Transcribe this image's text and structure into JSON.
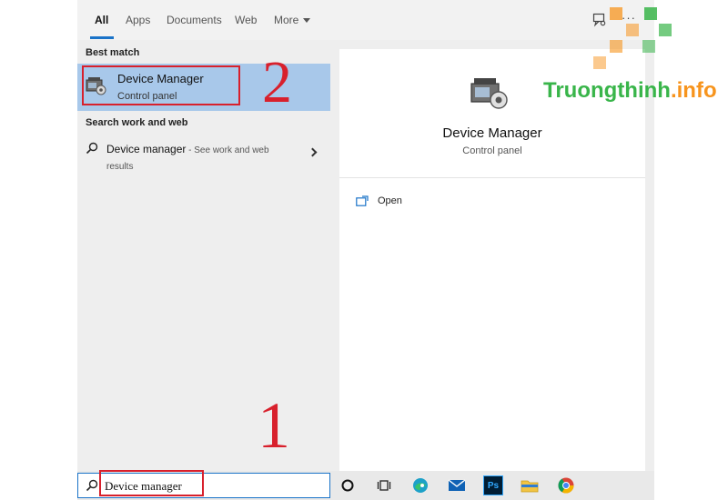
{
  "tabs": [
    {
      "label": "All",
      "active": true
    },
    {
      "label": "Apps",
      "active": false
    },
    {
      "label": "Documents",
      "active": false
    },
    {
      "label": "Web",
      "active": false
    },
    {
      "label": "More",
      "active": false
    }
  ],
  "header": {
    "more_icon": "ellipsis-icon",
    "feedback_icon": "feedback-icon",
    "ellipsis": "···"
  },
  "left": {
    "best_match_label": "Best match",
    "best_match": {
      "title": "Device Manager",
      "subtitle": "Control panel",
      "icon": "device-manager-icon"
    },
    "search_web_label": "Search work and web",
    "web_result": {
      "title": "Device manager",
      "suffix": " - See work and web results"
    }
  },
  "right": {
    "title": "Device Manager",
    "subtitle": "Control panel",
    "actions": [
      {
        "label": "Open",
        "icon": "open-icon"
      }
    ]
  },
  "taskbar": {
    "search_value": "Device manager",
    "icons": [
      "cortana-icon",
      "task-view-icon",
      "edge-icon",
      "mail-icon",
      "photoshop-icon",
      "file-explorer-icon",
      "chrome-icon"
    ],
    "photoshop_label": "Ps"
  },
  "annotations": {
    "step1": "1",
    "step2": "2"
  },
  "watermark": {
    "part1": "Truongthinh",
    "part2": ".info"
  },
  "colors": {
    "accent": "#1a73c8",
    "highlight": "#a8c8ea",
    "annotation_red": "#d8202c",
    "watermark_green": "#39b54a",
    "watermark_orange": "#f7941d"
  }
}
